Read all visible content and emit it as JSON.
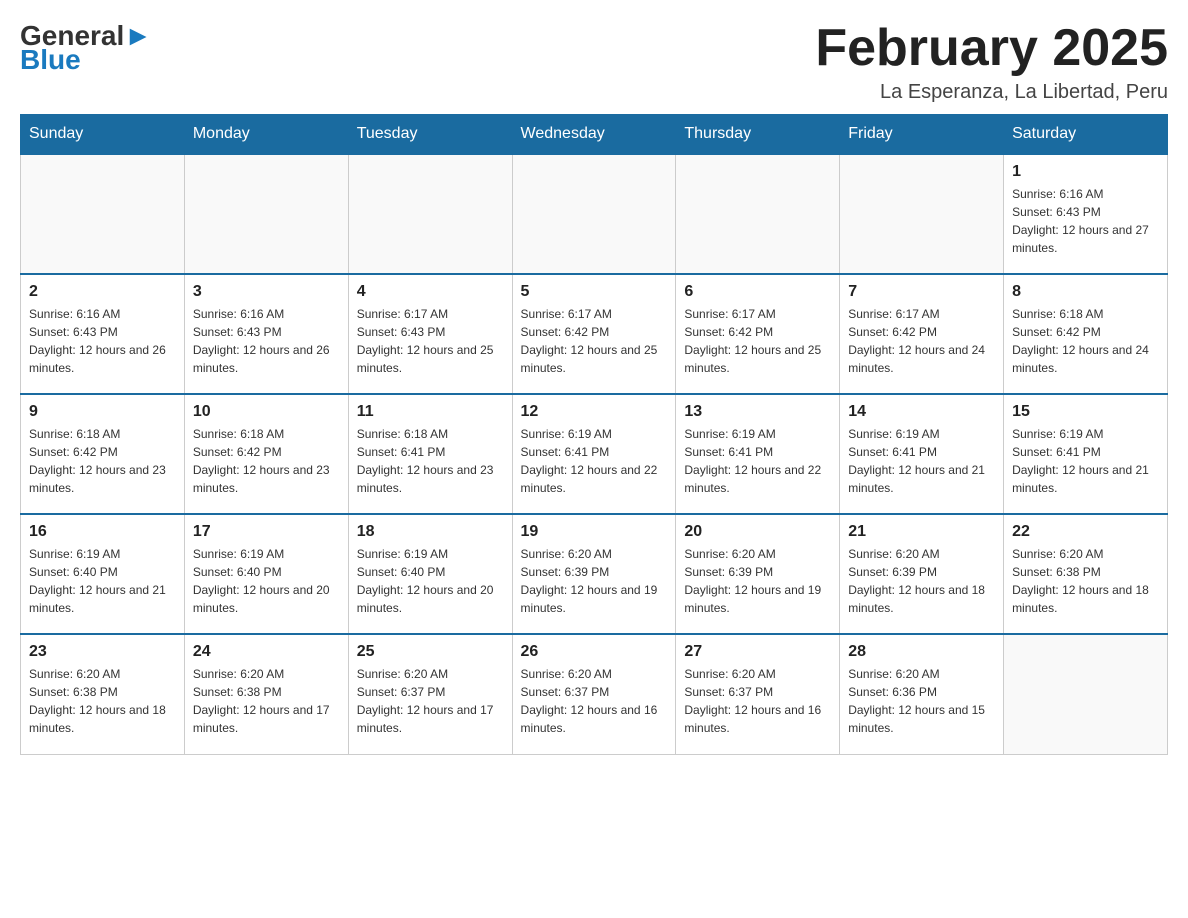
{
  "header": {
    "logo_general": "General",
    "logo_blue": "Blue",
    "month_year": "February 2025",
    "location": "La Esperanza, La Libertad, Peru"
  },
  "days_of_week": [
    "Sunday",
    "Monday",
    "Tuesday",
    "Wednesday",
    "Thursday",
    "Friday",
    "Saturday"
  ],
  "weeks": [
    [
      {
        "day": "",
        "info": ""
      },
      {
        "day": "",
        "info": ""
      },
      {
        "day": "",
        "info": ""
      },
      {
        "day": "",
        "info": ""
      },
      {
        "day": "",
        "info": ""
      },
      {
        "day": "",
        "info": ""
      },
      {
        "day": "1",
        "info": "Sunrise: 6:16 AM\nSunset: 6:43 PM\nDaylight: 12 hours and 27 minutes."
      }
    ],
    [
      {
        "day": "2",
        "info": "Sunrise: 6:16 AM\nSunset: 6:43 PM\nDaylight: 12 hours and 26 minutes."
      },
      {
        "day": "3",
        "info": "Sunrise: 6:16 AM\nSunset: 6:43 PM\nDaylight: 12 hours and 26 minutes."
      },
      {
        "day": "4",
        "info": "Sunrise: 6:17 AM\nSunset: 6:43 PM\nDaylight: 12 hours and 25 minutes."
      },
      {
        "day": "5",
        "info": "Sunrise: 6:17 AM\nSunset: 6:42 PM\nDaylight: 12 hours and 25 minutes."
      },
      {
        "day": "6",
        "info": "Sunrise: 6:17 AM\nSunset: 6:42 PM\nDaylight: 12 hours and 25 minutes."
      },
      {
        "day": "7",
        "info": "Sunrise: 6:17 AM\nSunset: 6:42 PM\nDaylight: 12 hours and 24 minutes."
      },
      {
        "day": "8",
        "info": "Sunrise: 6:18 AM\nSunset: 6:42 PM\nDaylight: 12 hours and 24 minutes."
      }
    ],
    [
      {
        "day": "9",
        "info": "Sunrise: 6:18 AM\nSunset: 6:42 PM\nDaylight: 12 hours and 23 minutes."
      },
      {
        "day": "10",
        "info": "Sunrise: 6:18 AM\nSunset: 6:42 PM\nDaylight: 12 hours and 23 minutes."
      },
      {
        "day": "11",
        "info": "Sunrise: 6:18 AM\nSunset: 6:41 PM\nDaylight: 12 hours and 23 minutes."
      },
      {
        "day": "12",
        "info": "Sunrise: 6:19 AM\nSunset: 6:41 PM\nDaylight: 12 hours and 22 minutes."
      },
      {
        "day": "13",
        "info": "Sunrise: 6:19 AM\nSunset: 6:41 PM\nDaylight: 12 hours and 22 minutes."
      },
      {
        "day": "14",
        "info": "Sunrise: 6:19 AM\nSunset: 6:41 PM\nDaylight: 12 hours and 21 minutes."
      },
      {
        "day": "15",
        "info": "Sunrise: 6:19 AM\nSunset: 6:41 PM\nDaylight: 12 hours and 21 minutes."
      }
    ],
    [
      {
        "day": "16",
        "info": "Sunrise: 6:19 AM\nSunset: 6:40 PM\nDaylight: 12 hours and 21 minutes."
      },
      {
        "day": "17",
        "info": "Sunrise: 6:19 AM\nSunset: 6:40 PM\nDaylight: 12 hours and 20 minutes."
      },
      {
        "day": "18",
        "info": "Sunrise: 6:19 AM\nSunset: 6:40 PM\nDaylight: 12 hours and 20 minutes."
      },
      {
        "day": "19",
        "info": "Sunrise: 6:20 AM\nSunset: 6:39 PM\nDaylight: 12 hours and 19 minutes."
      },
      {
        "day": "20",
        "info": "Sunrise: 6:20 AM\nSunset: 6:39 PM\nDaylight: 12 hours and 19 minutes."
      },
      {
        "day": "21",
        "info": "Sunrise: 6:20 AM\nSunset: 6:39 PM\nDaylight: 12 hours and 18 minutes."
      },
      {
        "day": "22",
        "info": "Sunrise: 6:20 AM\nSunset: 6:38 PM\nDaylight: 12 hours and 18 minutes."
      }
    ],
    [
      {
        "day": "23",
        "info": "Sunrise: 6:20 AM\nSunset: 6:38 PM\nDaylight: 12 hours and 18 minutes."
      },
      {
        "day": "24",
        "info": "Sunrise: 6:20 AM\nSunset: 6:38 PM\nDaylight: 12 hours and 17 minutes."
      },
      {
        "day": "25",
        "info": "Sunrise: 6:20 AM\nSunset: 6:37 PM\nDaylight: 12 hours and 17 minutes."
      },
      {
        "day": "26",
        "info": "Sunrise: 6:20 AM\nSunset: 6:37 PM\nDaylight: 12 hours and 16 minutes."
      },
      {
        "day": "27",
        "info": "Sunrise: 6:20 AM\nSunset: 6:37 PM\nDaylight: 12 hours and 16 minutes."
      },
      {
        "day": "28",
        "info": "Sunrise: 6:20 AM\nSunset: 6:36 PM\nDaylight: 12 hours and 15 minutes."
      },
      {
        "day": "",
        "info": ""
      }
    ]
  ]
}
